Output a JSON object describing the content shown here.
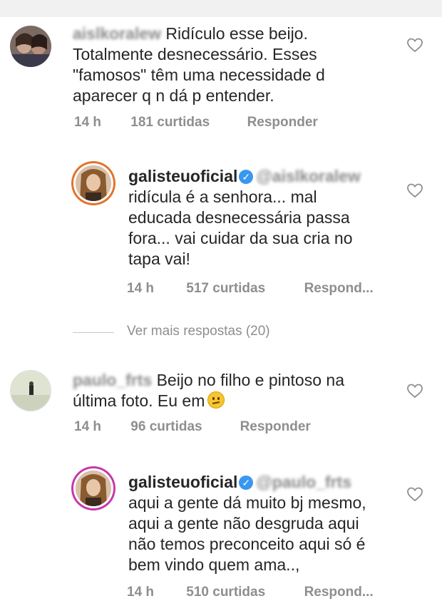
{
  "comments": [
    {
      "username": "aislkoralew",
      "text_first": "Ridículo esse beijo.",
      "text_lines": [
        "Totalmente desnecessário.  Esses",
        "\"famosos\" têm uma necessidade  d",
        "aparecer q n dá p entender."
      ],
      "time": "14 h",
      "likes": "181 curtidas",
      "reply": "Responder"
    },
    {
      "username": "galisteuoficial",
      "mention": "@aislkoralew",
      "text_lines": [
        "ridícula é a senhora... mal",
        "educada desnecessária passa",
        "fora... vai cuidar da sua cria no",
        "tapa vai!"
      ],
      "time": "14 h",
      "likes": "517 curtidas",
      "reply": "Respond..."
    },
    {
      "username": "paulo_frts",
      "text_first": "Beijo no filho e pintoso na",
      "text_lines": [
        "última foto. Eu em"
      ],
      "time": "14 h",
      "likes": "96 curtidas",
      "reply": "Responder"
    },
    {
      "username": "galisteuoficial",
      "mention": "@paulo_frts",
      "text_lines": [
        "aqui a gente dá muito bj mesmo,",
        "aqui a gente não desgruda aqui",
        "não temos preconceito aqui só é",
        "bem vindo quem ama..,"
      ],
      "time": "14 h",
      "likes": "510 curtidas",
      "reply": "Respond..."
    }
  ],
  "view_more": "Ver mais respostas (20)",
  "icons": {
    "like": "heart-icon",
    "verified": "verified-badge-icon",
    "emoji": "confused-face-emoji"
  },
  "colors": {
    "text": "#262626",
    "meta": "#8e8e8e",
    "verified": "#3897f0",
    "story_ring": "#e2732b"
  }
}
